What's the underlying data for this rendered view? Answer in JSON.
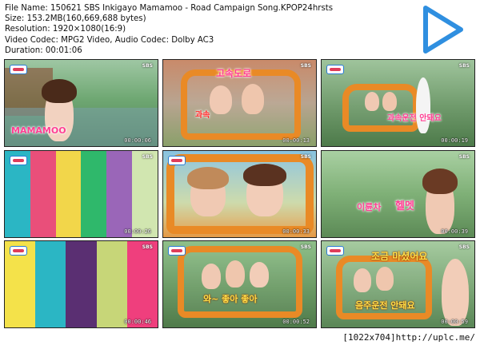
{
  "header": {
    "lines": [
      "File Name: 150621 SBS Inkigayo Mamamoo - Road Campaign Song.KPOP24hrsts",
      "Size: 153.2MB(160,669,688 bytes)",
      "Resolution: 1920×1080(16:9)",
      "Video Codec: MPG2 Video, Audio Codec: Dolby AC3",
      "Duration: 00:01:06"
    ]
  },
  "colors": {
    "play": "#2f8fe0",
    "car": "#e98a26",
    "pink": "#ff3f93"
  },
  "thumbs": [
    {
      "time": "00:00:06",
      "logo": "MAMAMOO",
      "network": "SBS"
    },
    {
      "time": "00:00:13",
      "caption1": "고속도로",
      "caption2": "과속",
      "network": "SBS"
    },
    {
      "time": "00:00:19",
      "caption1": "과속운전 안돼요",
      "network": "SBS"
    },
    {
      "time": "00:00:26",
      "network": "SBS"
    },
    {
      "time": "00:00:33",
      "network": "SBS"
    },
    {
      "time": "00:00:39",
      "caption1": "헬멧",
      "caption2": "이륜차",
      "network": "SBS"
    },
    {
      "time": "00:00:46",
      "network": "SBS"
    },
    {
      "time": "00:00:52",
      "caption1": "와~ 좋아 좋아",
      "network": "SBS"
    },
    {
      "time": "00:00:59",
      "caption1": "조금 마셨어요",
      "caption2": "음주운전 안돼요",
      "network": "SBS"
    }
  ],
  "footer": "[1022x704]http://uplc.me/"
}
